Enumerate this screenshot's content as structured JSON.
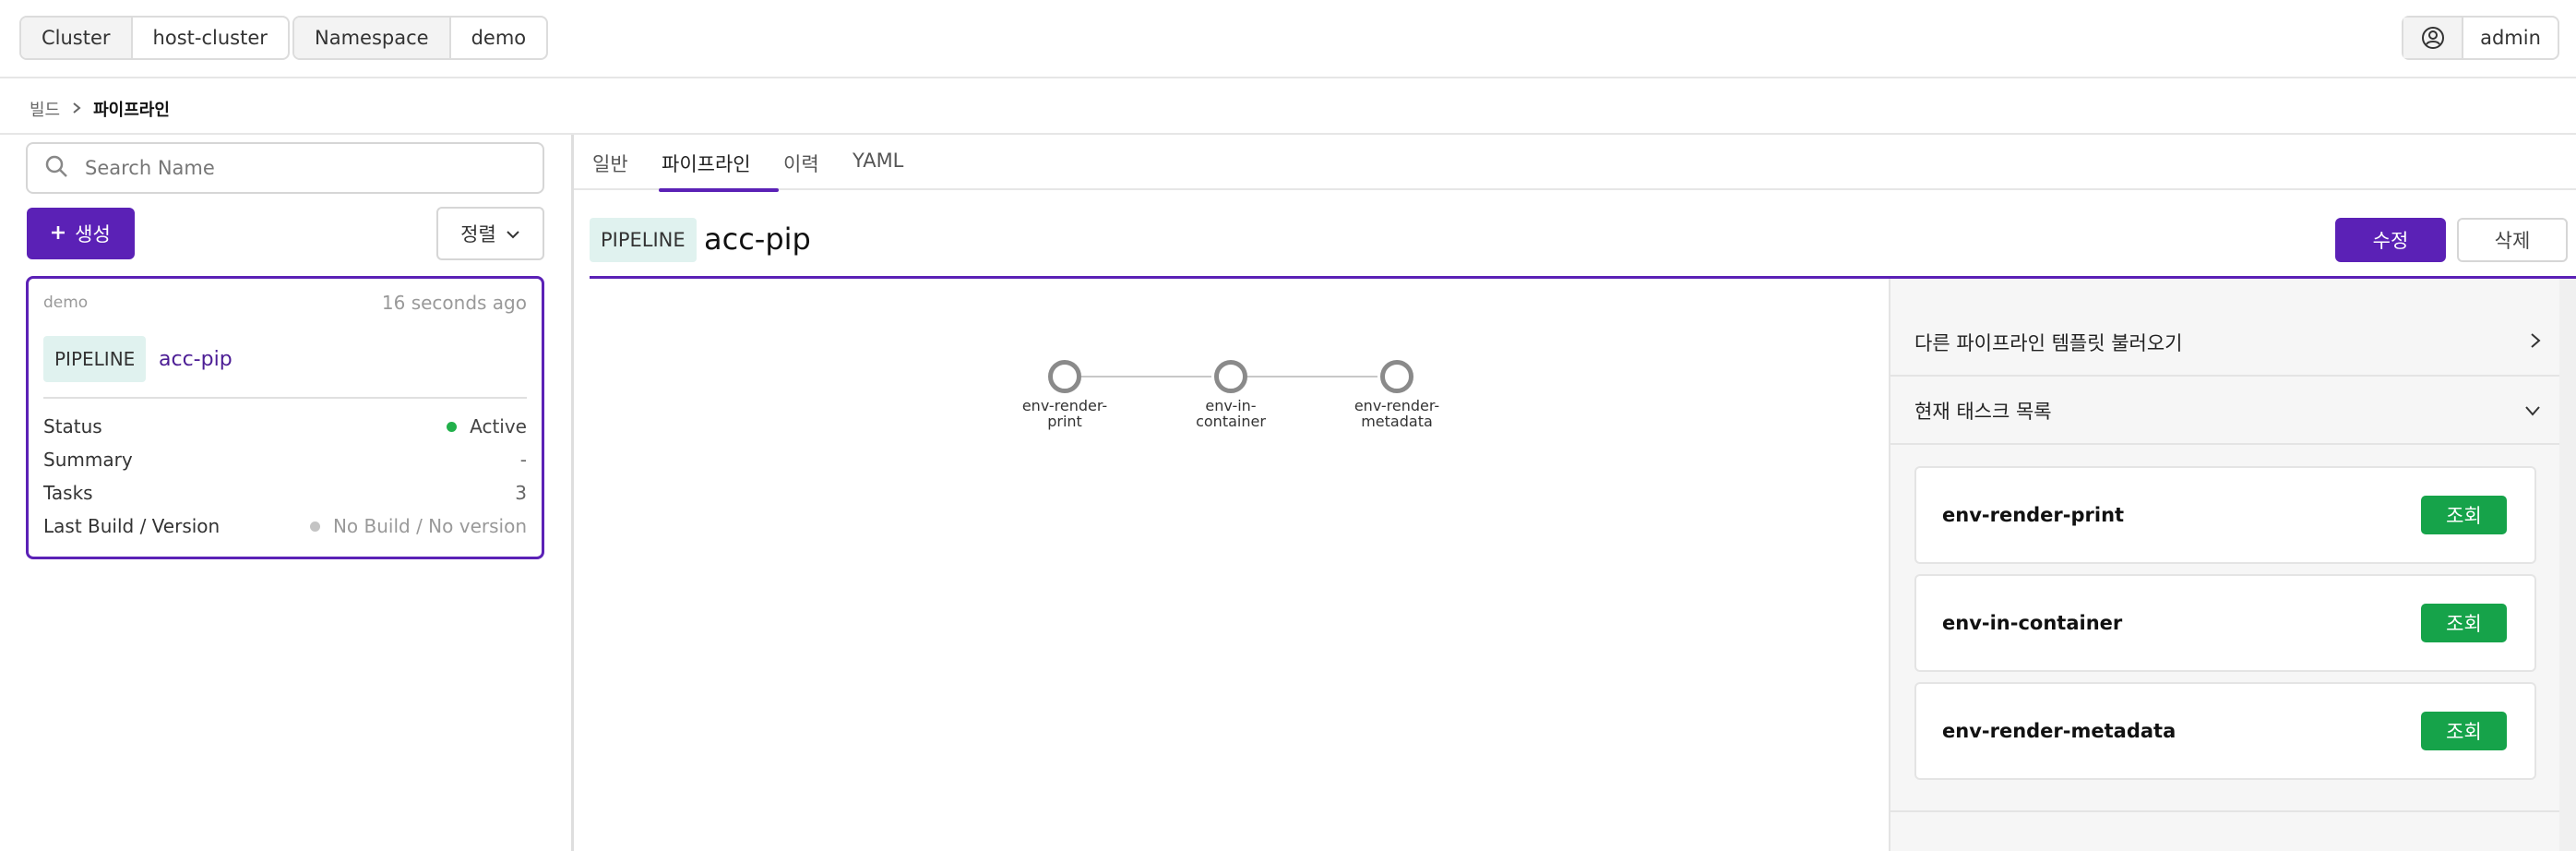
{
  "topbar": {
    "cluster_label": "Cluster",
    "cluster_value": "host-cluster",
    "namespace_label": "Namespace",
    "namespace_value": "demo",
    "user_icon": "user-circle-icon",
    "user_name": "admin"
  },
  "breadcrumb": {
    "parent": "빌드",
    "current": "파이프라인"
  },
  "sidebar": {
    "search_placeholder": "Search Name",
    "create_label": "생성",
    "sort_label": "정렬",
    "card": {
      "namespace": "demo",
      "time": "16 seconds ago",
      "badge": "PIPELINE",
      "name": "acc-pip",
      "rows": [
        {
          "label": "Status",
          "value": "Active"
        },
        {
          "label": "Summary",
          "value": "-"
        },
        {
          "label": "Tasks",
          "value": "3"
        },
        {
          "label": "Last Build / Version",
          "value": "No Build / No version"
        }
      ],
      "status_color": "#22b04b",
      "build_dot_color": "#c4c4c4"
    }
  },
  "tabs": [
    {
      "label": "일반"
    },
    {
      "label": "파이프라인"
    },
    {
      "label": "이력"
    },
    {
      "label": "YAML"
    }
  ],
  "detail": {
    "badge": "PIPELINE",
    "name": "acc-pip",
    "edit_label": "수정",
    "delete_label": "삭제"
  },
  "graph": {
    "nodes": [
      {
        "label": "env-render-print"
      },
      {
        "label": "env-in-container"
      },
      {
        "label": "env-render-metadata"
      }
    ]
  },
  "side": {
    "load_template_label": "다른 파이프라인 템플릿 불러오기",
    "current_tasks_label": "현재 태스크 목록",
    "tasks": [
      {
        "name": "env-render-print",
        "button": "조회"
      },
      {
        "name": "env-in-container",
        "button": "조회"
      },
      {
        "name": "env-render-metadata",
        "button": "조회"
      }
    ]
  },
  "colors": {
    "accent": "#5b21b6",
    "success": "#16a34a",
    "badge_bg": "#e0f2ef"
  }
}
